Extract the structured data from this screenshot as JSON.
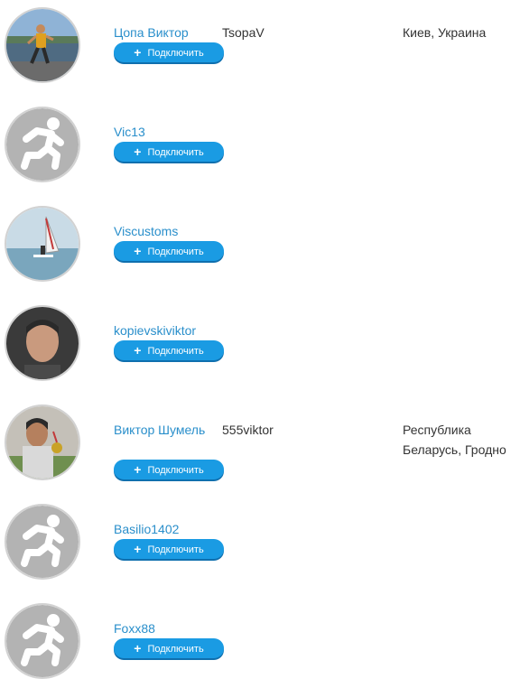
{
  "connect_label": "Подключить",
  "people": [
    {
      "name": "Цопа Виктор",
      "login": "TsopaV",
      "location": "Киев, Украина",
      "avatar": "photo-runner"
    },
    {
      "name": "Vic13",
      "login": "",
      "location": "",
      "avatar": "default-runner-icon"
    },
    {
      "name": "Viscustoms",
      "login": "",
      "location": "",
      "avatar": "photo-windsurfer"
    },
    {
      "name": "kopievskiviktor",
      "login": "",
      "location": "",
      "avatar": "photo-portrait"
    },
    {
      "name": "Виктор Шумель",
      "login": "555viktor",
      "location": "Республика Беларусь, Гродно",
      "avatar": "photo-medal"
    },
    {
      "name": "Basilio1402",
      "login": "",
      "location": "",
      "avatar": "default-runner-icon"
    },
    {
      "name": "Foxx88",
      "login": "",
      "location": "",
      "avatar": "default-runner-icon"
    }
  ],
  "colors": {
    "link": "#2a8fcb",
    "button": "#1a9be3",
    "default_avatar": "#b3b3b3"
  }
}
